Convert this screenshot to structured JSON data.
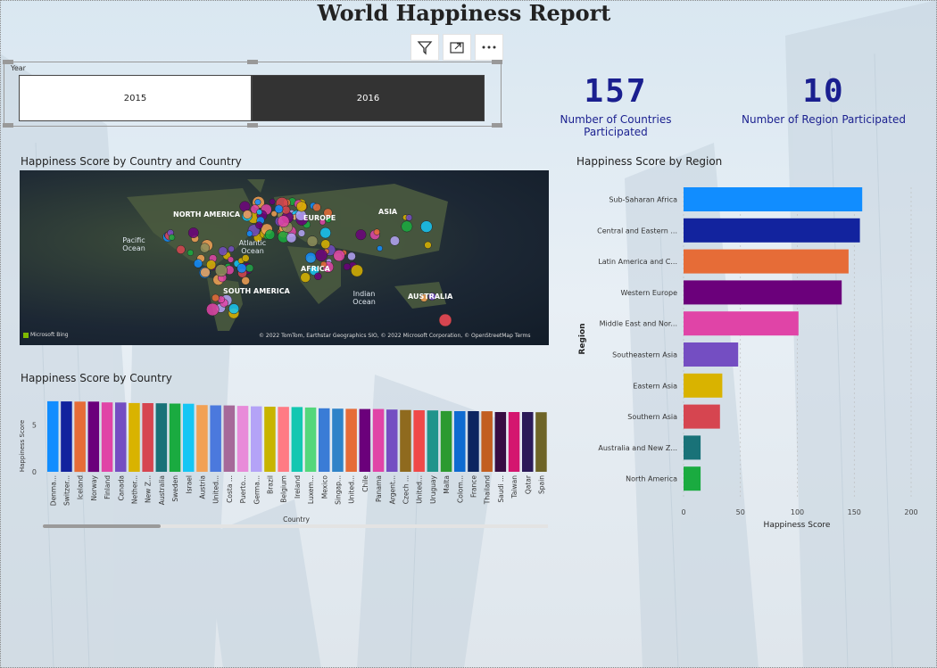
{
  "title": "World Happiness Report",
  "toolbar": {
    "filter_icon": "filter-icon",
    "focus_icon": "focus-mode-icon",
    "more_icon": "more-options-icon"
  },
  "slicer": {
    "label": "Year",
    "options": [
      {
        "label": "2015",
        "selected": false
      },
      {
        "label": "2016",
        "selected": true
      }
    ]
  },
  "kpis": [
    {
      "value": "157",
      "label": "Number of Countries Participated"
    },
    {
      "value": "10",
      "label": "Number of Region Participated"
    }
  ],
  "map": {
    "title": "Happiness Score by Country and Country",
    "continents": [
      "NORTH AMERICA",
      "EUROPE",
      "ASIA",
      "AFRICA",
      "SOUTH AMERICA",
      "AUSTRALIA"
    ],
    "oceans": [
      "Pacific\nOcean",
      "Atlantic\nOcean",
      "Indian\nOcean"
    ],
    "logo": "Microsoft Bing",
    "attribution": "© 2022 TomTom, Earthstar Geographics SIO, © 2022 Microsoft Corporation, © OpenStreetMap  Terms"
  },
  "chart_data": [
    {
      "type": "bar",
      "title": "Happiness Score by Country",
      "xlabel": "Country",
      "ylabel": "Happiness Score",
      "categories": [
        "Denma...",
        "Switzer...",
        "Iceland",
        "Norway",
        "Finland",
        "Canada",
        "Nether...",
        "New Z...",
        "Australia",
        "Sweden",
        "Israel",
        "Austria",
        "United...",
        "Costa ...",
        "Puerto...",
        "Germa...",
        "Brazil",
        "Belgium",
        "Ireland",
        "Luxem...",
        "Mexico",
        "Singap...",
        "United...",
        "Chile",
        "Panama",
        "Argent...",
        "Czech ...",
        "United...",
        "Uruguay",
        "Malta",
        "Colom...",
        "France",
        "Thailand",
        "Saudi ...",
        "Taiwan",
        "Qatar",
        "Spain"
      ],
      "values": [
        7.53,
        7.51,
        7.5,
        7.5,
        7.41,
        7.4,
        7.34,
        7.33,
        7.31,
        7.29,
        7.27,
        7.12,
        7.1,
        7.09,
        7.04,
        6.99,
        6.95,
        6.93,
        6.91,
        6.87,
        6.78,
        6.74,
        6.72,
        6.7,
        6.7,
        6.65,
        6.6,
        6.57,
        6.55,
        6.49,
        6.48,
        6.48,
        6.47,
        6.38,
        6.38,
        6.38,
        6.36
      ],
      "colors": [
        "#118DFF",
        "#12239E",
        "#E66C37",
        "#6B007B",
        "#E044A7",
        "#744EC2",
        "#D9B300",
        "#D64550",
        "#197278",
        "#1AAB40",
        "#15C6F4",
        "#F2A155",
        "#4B79DD",
        "#A66999",
        "#E88BD9",
        "#B4A3F7",
        "#C8B400",
        "#FF7B84",
        "#13C7B1",
        "#54D77B",
        "#3A7CD6",
        "#2F83C8",
        "#E66C37",
        "#6B007B",
        "#E044A7",
        "#744EC2",
        "#8F6A1E",
        "#F04949",
        "#20948B",
        "#2C9A30",
        "#0E6BD1",
        "#0C2560",
        "#C25E20",
        "#380D43",
        "#D4166F",
        "#2B1A58",
        "#6E6427"
      ],
      "yticks": [
        "5",
        "0"
      ],
      "ylim": [
        0,
        8
      ]
    },
    {
      "type": "bar",
      "orientation": "horizontal",
      "title": "Happiness Score by Region",
      "xlabel": "Happiness Score",
      "ylabel": "Region",
      "categories": [
        "Sub-Saharan Africa",
        "Central and Eastern ...",
        "Latin America and C...",
        "Western Europe",
        "Middle East and Nor...",
        "Southeastern Asia",
        "Eastern Asia",
        "Southern Asia",
        "Australia and New Z...",
        "North America"
      ],
      "values": [
        157,
        155,
        145,
        139,
        101,
        48,
        34,
        32,
        15,
        15
      ],
      "colors": [
        "#118DFF",
        "#12239E",
        "#E66C37",
        "#6B007B",
        "#E044A7",
        "#744EC2",
        "#D9B300",
        "#D64550",
        "#197278",
        "#1AAB40"
      ],
      "xticks": [
        0,
        50,
        100,
        150,
        200
      ],
      "xlim": [
        0,
        200
      ]
    }
  ]
}
